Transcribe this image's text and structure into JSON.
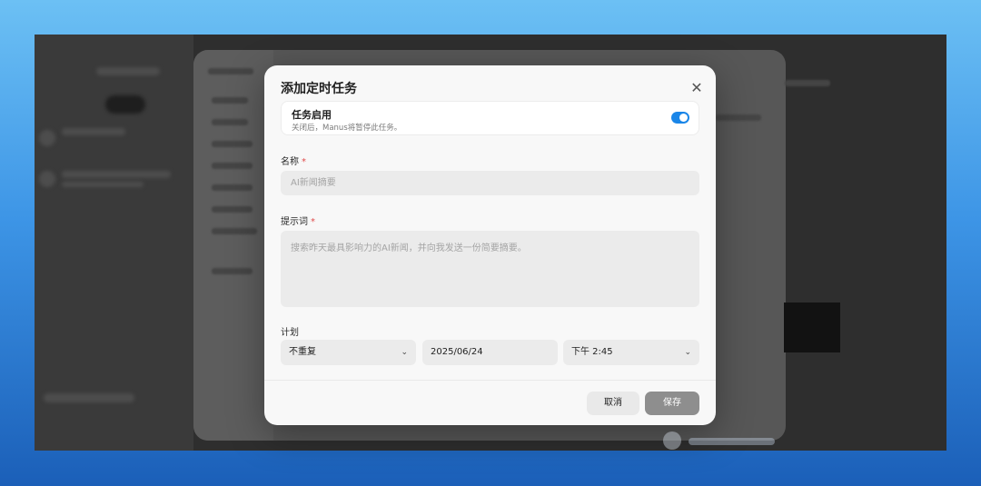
{
  "modal": {
    "title": "添加定时任务",
    "close_icon": "close-icon",
    "enable_toggle": {
      "title": "任务启用",
      "description": "关闭后，Manus将暂停此任务。",
      "enabled": true,
      "accent_color": "#1a86e8"
    },
    "name_field": {
      "label": "名称",
      "required_mark": "*",
      "placeholder": "AI新闻摘要"
    },
    "prompt_field": {
      "label": "提示词",
      "required_mark": "*",
      "placeholder": "搜索昨天最具影响力的AI新闻，并向我发送一份简要摘要。"
    },
    "schedule": {
      "label": "计划",
      "repeat_value": "不重复",
      "date_value": "2025/06/24",
      "time_value": "下午 2:45",
      "chevron_icon": "chevron-down-icon"
    },
    "actions": {
      "cancel_label": "取消",
      "save_label": "保存"
    }
  }
}
